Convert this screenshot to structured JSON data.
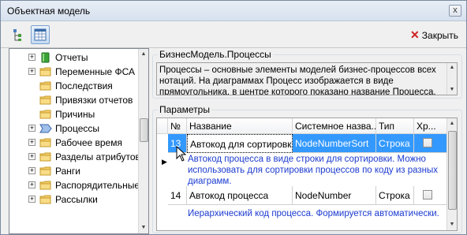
{
  "window": {
    "title": "Объектная модель",
    "close_glyph": "x"
  },
  "toolbar": {
    "close_label": "Закрыть",
    "icons": [
      "tree-structure-icon",
      "table-view-icon"
    ]
  },
  "tree": {
    "items": [
      {
        "label": "Отчеты",
        "expander": "+",
        "icon": "green-book"
      },
      {
        "label": "Переменные ФСА",
        "expander": "+",
        "icon": "folder"
      },
      {
        "label": "Последствия",
        "expander": "",
        "icon": "folder"
      },
      {
        "label": "Привязки отчетов",
        "expander": "",
        "icon": "folder"
      },
      {
        "label": "Причины",
        "expander": "",
        "icon": "folder"
      },
      {
        "label": "Процессы",
        "expander": "+",
        "icon": "process-chevron"
      },
      {
        "label": "Рабочее время",
        "expander": "+",
        "icon": "folder"
      },
      {
        "label": "Разделы атрибутов",
        "expander": "+",
        "icon": "folder"
      },
      {
        "label": "Ранги",
        "expander": "+",
        "icon": "folder"
      },
      {
        "label": "Распорядительные",
        "expander": "+",
        "icon": "folder"
      },
      {
        "label": "Рассылки",
        "expander": "+",
        "icon": "folder"
      }
    ]
  },
  "description": {
    "group_label": "БизнесМодель.Процессы",
    "text": "Процессы – основные элементы моделей бизнес-процессов всех нотаций. На диаграммах Процесс изображается в виде прямоугольника, в центре которого показано название Процесса."
  },
  "params": {
    "group_label": "Параметры",
    "columns": [
      "№",
      "Название",
      "Системное назва...",
      "Тип",
      "Хр..."
    ],
    "rows": [
      {
        "num": "13",
        "name": "Автокод для сортировки",
        "sysname": "NodeNumberSort",
        "type": "Строка",
        "checked": false,
        "description": "Автокод процесса в виде строки для сортировки. Можно использовать для сортировки процессов по коду из разных диаграмм."
      },
      {
        "num": "14",
        "name": "Автокод процесса",
        "sysname": "NodeNumber",
        "type": "Строка",
        "checked": false,
        "description": "Иерархический код процесса. Формируется автоматически."
      }
    ]
  },
  "colors": {
    "selection": "#3399ff",
    "description_text": "#1c3bd0",
    "close_icon": "#d02020"
  }
}
